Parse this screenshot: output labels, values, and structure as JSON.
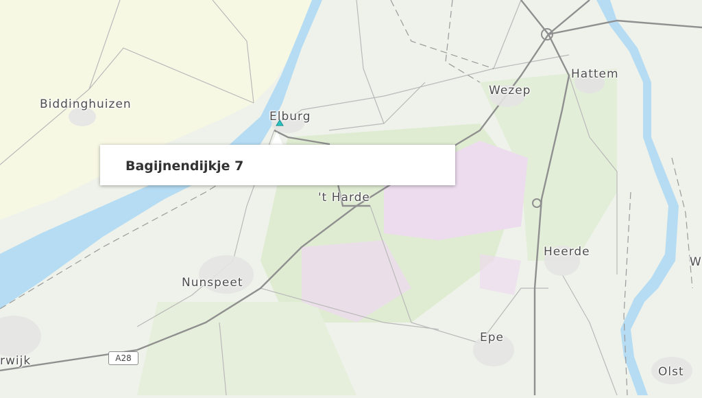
{
  "map": {
    "places": {
      "biddinghuizen": "Biddinghuizen",
      "elburg": "Elburg",
      "wezep": "Wezep",
      "hattem": "Hattem",
      "t_harde": "'t Harde",
      "heerde": "Heerde",
      "nunspeet": "Nunspeet",
      "epe": "Epe",
      "harderwijk_partial": "rwijk",
      "olst": "Olst",
      "w_partial": "W"
    },
    "road_shield": "A28",
    "colors": {
      "water": "#b5dcf3",
      "land": "#eef2ea",
      "polder": "#f7f8e4",
      "forest": "#dfecd2",
      "heath": "#ecdcee",
      "road": "#9a9a9a"
    }
  },
  "popup": {
    "title": "Bagijnendijkje 7"
  }
}
